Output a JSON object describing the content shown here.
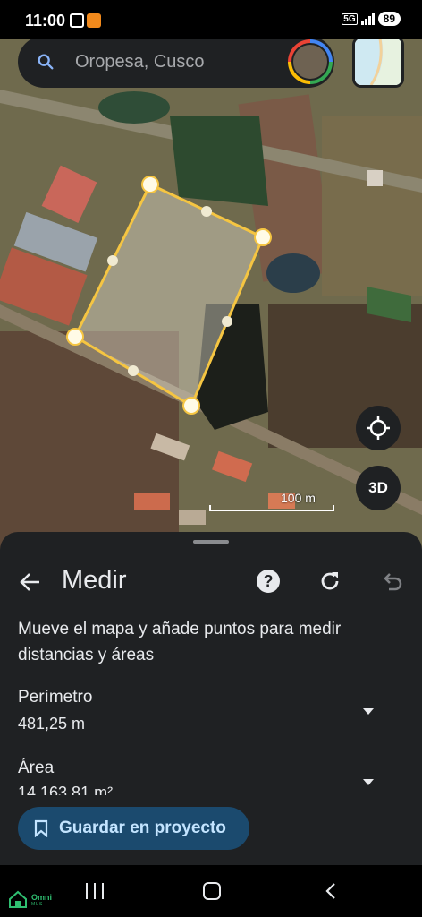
{
  "status_bar": {
    "time": "11:00",
    "network": "5G",
    "battery": "89"
  },
  "search": {
    "query": "Oropesa, Cusco"
  },
  "map": {
    "scale_label": "100 m",
    "three_d_label": "3D",
    "polygon_color": "#f5c542"
  },
  "measure": {
    "title": "Medir",
    "instructions": "Mueve el mapa y añade puntos para medir distancias y áreas",
    "perimeter_label": "Perímetro",
    "perimeter_value": "481,25 m",
    "area_label": "Área",
    "area_value": "14.163,81 m²"
  },
  "save": {
    "label": "Guardar en proyecto"
  },
  "watermark": {
    "brand": "Omni",
    "sub": "MLS"
  },
  "colors": {
    "sheet_bg": "#1f2123",
    "button_bg": "#1b4a6e",
    "button_text": "#c3e4ff"
  }
}
